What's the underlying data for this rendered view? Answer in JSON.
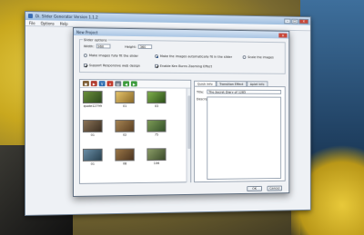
{
  "main_window": {
    "title": "Di. Slider Generator Version 1.1.2",
    "menu": [
      "File",
      "Options",
      "Help"
    ]
  },
  "dialog": {
    "title": "New Project",
    "group_title": "Slider options",
    "width_label": "Width:",
    "width_value": "960",
    "height_label": "Height:",
    "height_value": "360",
    "options": {
      "fit_images": "Make images fully fit the slider",
      "make_auto_fit": "Make the images automatically fit in the slider",
      "scale_images": "Scale the images",
      "responsive": "Support Responsive web design",
      "ken_burns": "Enable Ken Burns Zooming Effect"
    },
    "thumbnails": [
      {
        "caption": "quote12799",
        "color": "#6a8f3a"
      },
      {
        "caption": "01",
        "color": "#caa14a"
      },
      {
        "caption": "03",
        "color": "#4b7a2e"
      },
      {
        "caption": "01",
        "color": "#6e5a42"
      },
      {
        "caption": "02",
        "color": "#8a6a3c"
      },
      {
        "caption": "75",
        "color": "#5d7e3f"
      },
      {
        "caption": "01",
        "color": "#4b6b80"
      },
      {
        "caption": "08",
        "color": "#7d5e39"
      },
      {
        "caption": "106",
        "color": "#6a7c4d"
      }
    ],
    "tabs": [
      "Quick Info",
      "Transition Effect",
      "Aplet Info"
    ],
    "title_label": "Title:",
    "title_value": "The Secret Diary of 1285",
    "description_label": "Description:",
    "ok_label": "OK",
    "cancel_label": "Cancel"
  },
  "colors": {
    "accent": "#3a6db3",
    "titlebar": "#a9c5e3",
    "close": "#c9483a"
  }
}
